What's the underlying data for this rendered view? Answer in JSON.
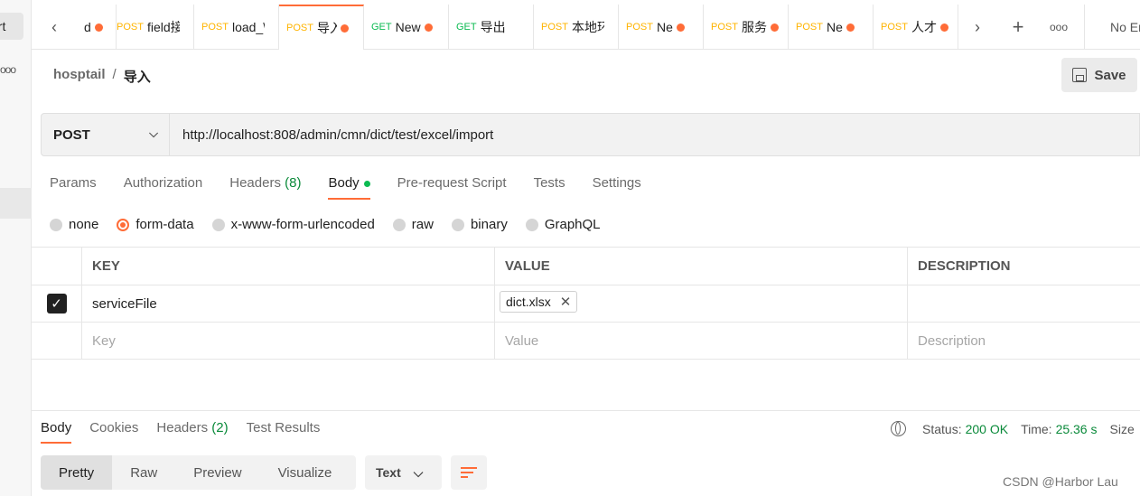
{
  "sidebar": {
    "import_label": "ort",
    "more_dots": "ooo"
  },
  "tabs": [
    {
      "method": "",
      "name": "d",
      "dot": true
    },
    {
      "method": "POST",
      "name": "field接",
      "dot": false
    },
    {
      "method": "POST",
      "name": "load_\\",
      "dot": false
    },
    {
      "method": "POST",
      "name": "导入",
      "dot": true,
      "active": true
    },
    {
      "method": "GET",
      "name": "New",
      "dot": true
    },
    {
      "method": "GET",
      "name": "导出",
      "dot": false
    },
    {
      "method": "POST",
      "name": "本地环",
      "dot": false
    },
    {
      "method": "POST",
      "name": "Ne",
      "dot": true
    },
    {
      "method": "POST",
      "name": "服务",
      "dot": true
    },
    {
      "method": "POST",
      "name": "Ne",
      "dot": true
    },
    {
      "method": "POST",
      "name": "人才",
      "dot": true
    }
  ],
  "tabbar": {
    "env_label": "No Er",
    "more_label": "ooo"
  },
  "breadcrumb": {
    "workspace": "hosptail",
    "separator": "/",
    "request": "导入"
  },
  "save_label": "Save",
  "request": {
    "method": "POST",
    "url": "http://localhost:808/admin/cmn/dict/test/excel/import"
  },
  "request_tabs": {
    "params": "Params",
    "authorization": "Authorization",
    "headers": "Headers",
    "headers_count": "(8)",
    "body": "Body",
    "prerequest": "Pre-request Script",
    "tests": "Tests",
    "settings": "Settings"
  },
  "body_types": {
    "none": "none",
    "form_data": "form-data",
    "urlencoded": "x-www-form-urlencoded",
    "raw": "raw",
    "binary": "binary",
    "graphql": "GraphQL"
  },
  "params_table": {
    "headers": {
      "key": "KEY",
      "value": "VALUE",
      "description": "DESCRIPTION"
    },
    "row": {
      "key": "serviceFile",
      "file": "dict.xlsx"
    },
    "placeholders": {
      "key": "Key",
      "value": "Value",
      "description": "Description"
    }
  },
  "response_tabs": {
    "body": "Body",
    "cookies": "Cookies",
    "headers": "Headers",
    "headers_count": "(2)",
    "test_results": "Test Results"
  },
  "response_status": {
    "status_label": "Status:",
    "status_value": "200 OK",
    "time_label": "Time:",
    "time_value": "25.36 s",
    "size_label": "Size"
  },
  "view_modes": {
    "pretty": "Pretty",
    "raw": "Raw",
    "preview": "Preview",
    "visualize": "Visualize"
  },
  "format": "Text",
  "watermark": "CSDN @Harbor Lau",
  "colors": {
    "accent": "#ff6c37",
    "post": "#ffb400",
    "get": "#0cbb52",
    "status_ok": "#0a8a3a"
  }
}
